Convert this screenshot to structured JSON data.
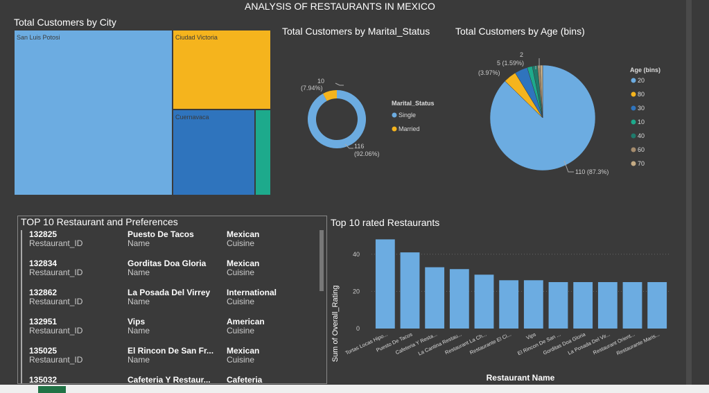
{
  "header": {
    "title": "ANALYSIS OF RESTAURANTS IN MEXICO"
  },
  "colors": {
    "light_blue": "#6cace1",
    "yellow": "#f5b41d",
    "blue": "#2f74bd",
    "teal": "#1daa8c",
    "dark_teal": "#1f7b6c",
    "tan": "#a58c6d",
    "beige": "#c4ab84",
    "background": "#3a3a3a"
  },
  "treemap": {
    "title": "Total Customers by City",
    "cells": [
      {
        "label": "San Luis Potosi",
        "color": "#6cace1"
      },
      {
        "label": "Ciudad Victoria",
        "color": "#f5b41d"
      },
      {
        "label": "Cuernavaca",
        "color": "#2f74bd"
      },
      {
        "label": "",
        "color": "#1daa8c"
      }
    ]
  },
  "donut": {
    "title": "Total Customers by Marital_Status",
    "legend_title": "Marital_Status",
    "slices": [
      {
        "name": "Single",
        "value": 116,
        "label_value": "116",
        "label_pct": "(92.06%)",
        "color": "#6cace1"
      },
      {
        "name": "Married",
        "value": 10,
        "label_value": "10",
        "label_pct": "(7.94%)",
        "color": "#f5b41d"
      }
    ]
  },
  "pie": {
    "title": "Total Customers by Age (bins)",
    "legend_title": "Age (bins)",
    "slices": [
      {
        "name": "20",
        "value": 110,
        "color": "#6cace1"
      },
      {
        "name": "80",
        "value": 5,
        "color": "#f5b41d"
      },
      {
        "name": "30",
        "value": 5,
        "color": "#2f74bd"
      },
      {
        "name": "10",
        "value": 2,
        "color": "#1daa8c"
      },
      {
        "name": "40",
        "value": 2,
        "color": "#1f7b6c"
      },
      {
        "name": "60",
        "value": 1,
        "color": "#a58c6d"
      },
      {
        "name": "70",
        "value": 1,
        "color": "#c4ab84"
      }
    ],
    "labels": {
      "big": "110 (87.3%)",
      "a_top": "5 (1.59%)",
      "a_bottom": "(3.97%)",
      "b": "2"
    }
  },
  "table": {
    "title": "TOP 10 Restaurant and Preferences",
    "key_labels": {
      "id": "Restaurant_ID",
      "name": "Name",
      "cuisine": "Cuisine"
    },
    "rows": [
      {
        "id": "132825",
        "name": "Puesto De Tacos",
        "cuisine": "Mexican"
      },
      {
        "id": "132834",
        "name": "Gorditas Doa Gloria",
        "cuisine": "Mexican"
      },
      {
        "id": "132862",
        "name": "La Posada Del Virrey",
        "cuisine": "International"
      },
      {
        "id": "132951",
        "name": "Vips",
        "cuisine": "American"
      },
      {
        "id": "135025",
        "name": "El Rincon De San Fr...",
        "cuisine": "Mexican"
      },
      {
        "id": "135032",
        "name": "Cafeteria Y Restaur...",
        "cuisine": "Cafeteria"
      }
    ]
  },
  "chart_data": {
    "type": "bar",
    "title": "Top 10 rated Restaurants",
    "xlabel": "Restaurant Name",
    "ylabel": "Sum of Overall_Rating",
    "ylim": [
      0,
      50
    ],
    "yticks": [
      0,
      20,
      40
    ],
    "categories": [
      "Tortas Locas Hipo...",
      "Puesto De Tacos",
      "Cafeteria Y Resta...",
      "La Cantina Restau...",
      "Restaurant La Ch...",
      "Restaurante El Ci...",
      "Vips",
      "El Rincon De San ...",
      "Gorditas Doa Gloria",
      "La Posada Del Vir...",
      "Restaurant Orient...",
      "Restaurante Maris..."
    ],
    "values": [
      48,
      41,
      33,
      32,
      29,
      26,
      26,
      25,
      25,
      25,
      25,
      25
    ],
    "color": "#6cace1",
    "grid": true
  }
}
